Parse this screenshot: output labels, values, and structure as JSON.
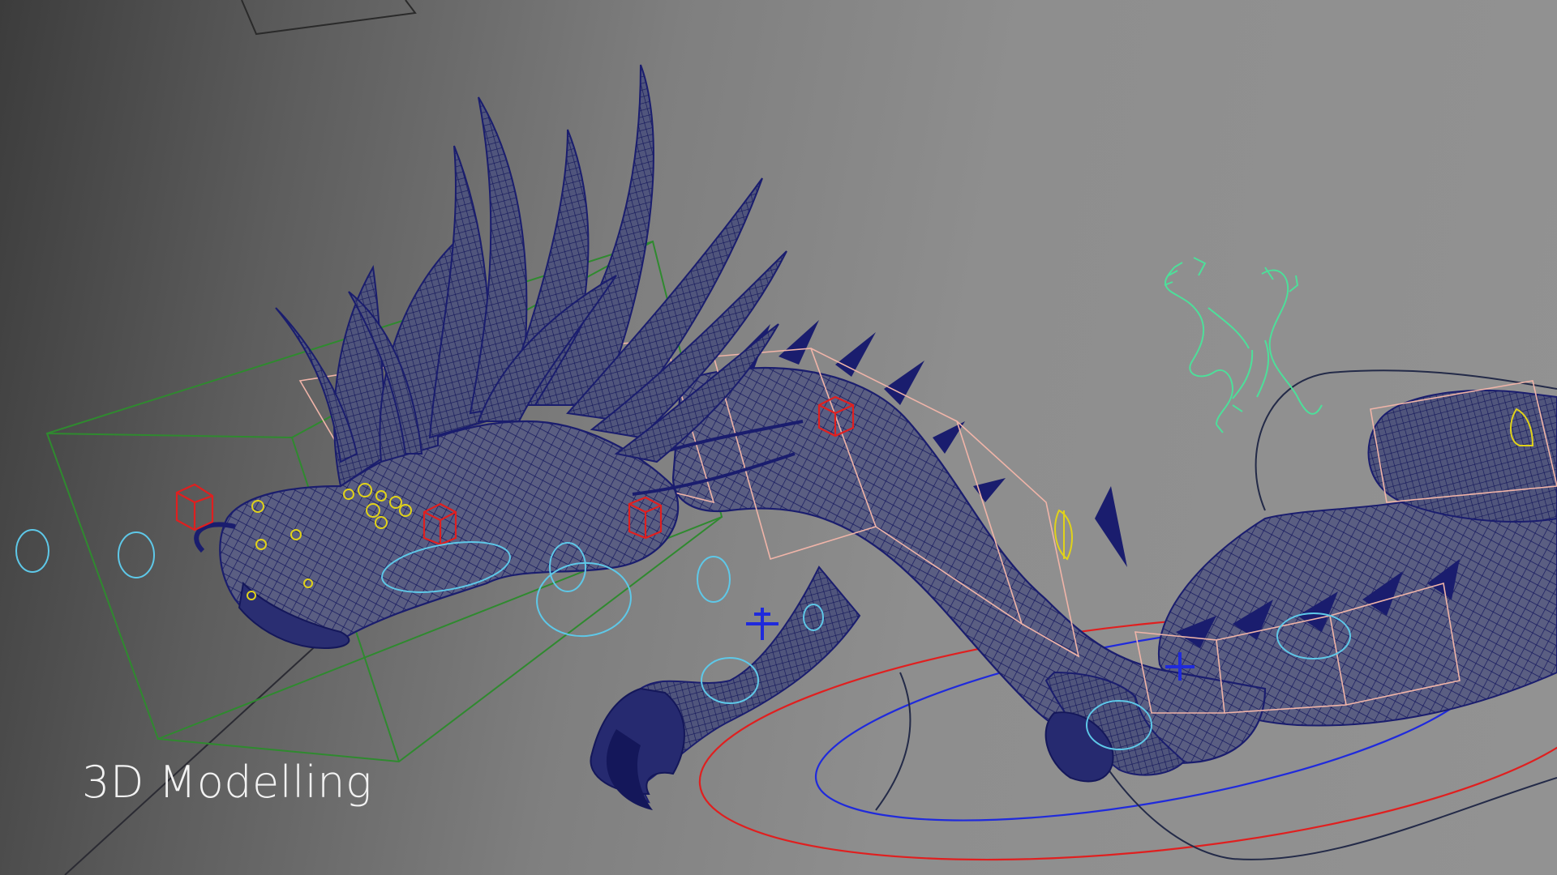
{
  "caption": "3D Modelling",
  "palette": {
    "mesh": "#1a1d6e",
    "mesh_fill": "#5b5f80",
    "bbox_green": "#2f8a2f",
    "bbox_pink": "#f0b4a8",
    "control_red": "#e01f1f",
    "control_yellow": "#e0d21a",
    "control_cyan": "#5ec8e8",
    "control_blue": "#1f2adc",
    "icon_green": "#4ddf9a",
    "curve_dark": "#232a48"
  },
  "icons": [
    "dragon-icon",
    "move-manipulator-icon"
  ]
}
